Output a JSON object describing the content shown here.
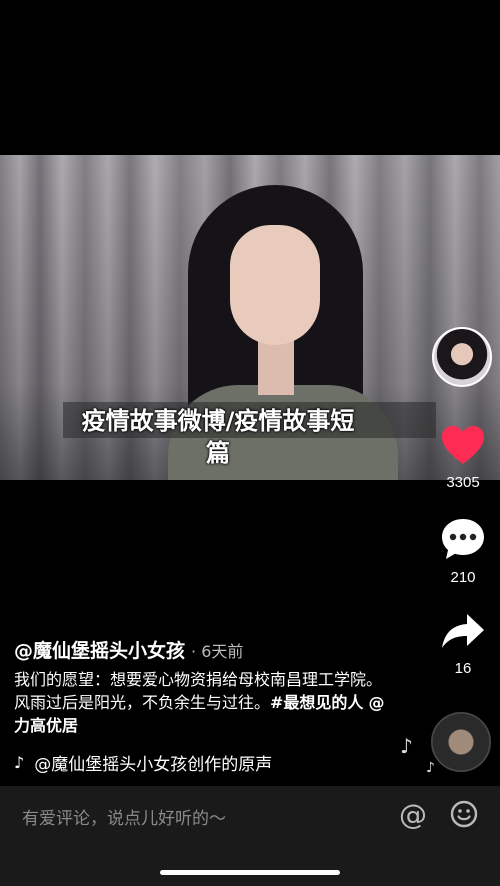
{
  "video": {
    "title_line1": "疫情故事微博/疫情故事短",
    "title_line2": "篇"
  },
  "rail": {
    "like_count": "3305",
    "comment_count": "210",
    "share_count": "16"
  },
  "post": {
    "author": "@魔仙堡摇头小女孩",
    "time": "· 6天前",
    "description_prefix": "我们的愿望：想要爱心物资捐给母校南昌理工学院。风雨过后是阳光，不负余生与过往。",
    "hashtag": "#最想见的人",
    "mention": "@力高优居",
    "music": "@魔仙堡摇头小女孩创作的原声"
  },
  "comment_bar": {
    "placeholder": "有爱评论，说点儿好听的～"
  },
  "colors": {
    "like": "#fe2c55",
    "background": "#000000",
    "comment_bar": "#1a1a1a"
  }
}
